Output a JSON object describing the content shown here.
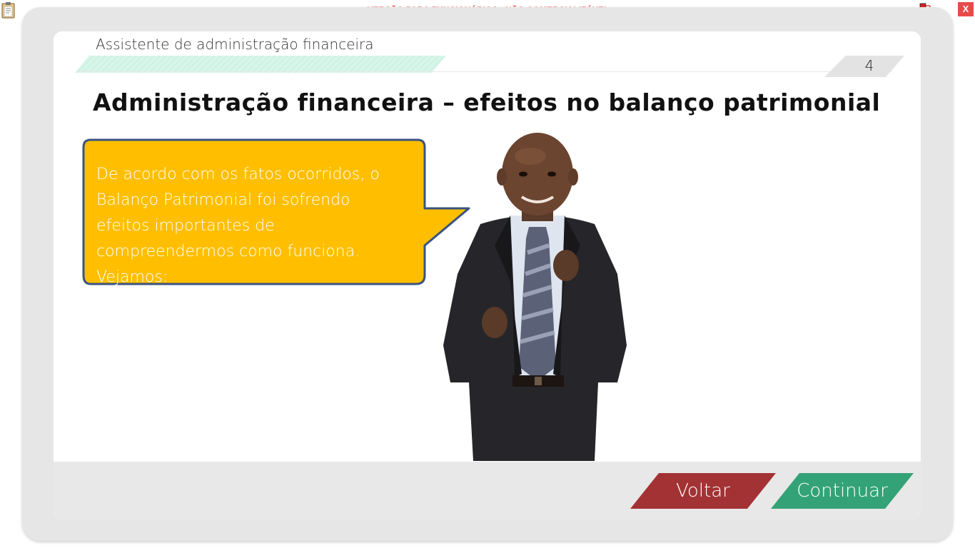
{
  "app": {
    "watermark": "VERSÃO PARA FUNCIONÁRIOS - NÃO COMERCIALIZÁVEL",
    "close_label": "X"
  },
  "header": {
    "course_title": "Assistente de administração financeira",
    "page_number": "4"
  },
  "content": {
    "heading": "Administração financeira – efeitos no balanço patrimonial",
    "speech_bubble": "De acordo com os fatos ocorridos, o Balanço Patrimonial foi sofrendo efeitos importantes de compreendermos como funciona. Vejamos:"
  },
  "navigation": {
    "back_label": "Voltar",
    "next_label": "Continuar"
  },
  "colors": {
    "bubble_fill": "#ffbf00",
    "bubble_border": "#3a5382",
    "back_button": "#a33234",
    "next_button": "#33a377",
    "accent_stripe": "#d8f5ea"
  },
  "icons": {
    "top_left": "clipboard-icon",
    "top_right": "network-status-icon"
  }
}
